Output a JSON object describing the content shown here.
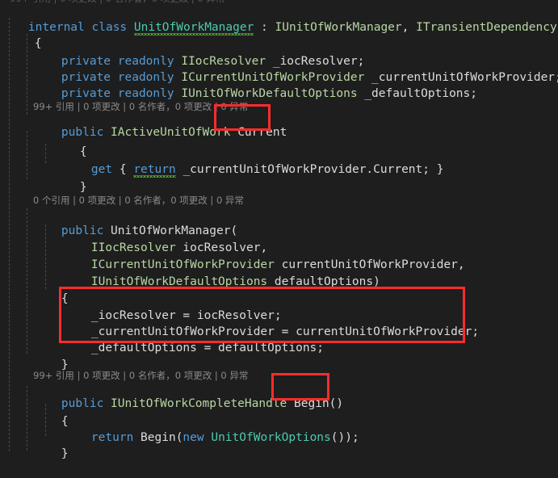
{
  "editor": {
    "theme": "visual-studio-dark",
    "background_color": "#1e1e1e",
    "foreground_color": "#dcdcdc",
    "colors": {
      "keyword": "#569cd6",
      "user_type": "#4ec9b0",
      "interface": "#b8d7a3",
      "identifier": "#dcdcdc",
      "codelens": "#8a8a8a",
      "annotation": "#fb2c2c",
      "squiggle": "#4ea72e",
      "indent_guide": "#4a4a4a"
    },
    "language": "csharp"
  },
  "code": {
    "class_declaration": {
      "modifier": "internal",
      "keyword_class": "class",
      "name": "UnitOfWorkManager",
      "colon": " : ",
      "base_1": "IUnitOfWorkManager",
      "separator": ", ",
      "base_2": "ITransientDependency"
    },
    "brace_open_class": "{",
    "fields": [
      {
        "modifier": "private",
        "readonly": "readonly",
        "type": "IIocResolver",
        "name": " _iocResolver;"
      },
      {
        "modifier": "private",
        "readonly": "readonly",
        "type": "ICurrentUnitOfWorkProvider",
        "name": " _currentUnitOfWorkProvider;"
      },
      {
        "modifier": "private",
        "readonly": "readonly",
        "type": "IUnitOfWorkDefaultOptions",
        "name": " _defaultOptions;"
      }
    ],
    "codelens": [
      "99+ 引用 | 0 项更改 | 0 名作者，0 项更改 | 0 异常",
      "0 个引用 | 0 项更改 | 0 名作者，0 项更改 | 0 异常",
      "99+ 引用 | 0 项更改 | 0 名作者，0 项更改 | 0 异常"
    ],
    "property": {
      "modifier": "public",
      "type": "IActiveUnitOfWork",
      "name": "Current",
      "brace_open": "{",
      "getter": {
        "get_keyword": "get",
        "brace_open": " { ",
        "return_keyword": "return",
        "expression": " _currentUnitOfWorkProvider.Current; ",
        "brace_close": "}"
      },
      "brace_close": "}"
    },
    "constructor": {
      "modifier": "public",
      "name": "UnitOfWorkManager(",
      "parameters": [
        {
          "type": "IIocResolver",
          "name": " iocResolver,"
        },
        {
          "type": "ICurrentUnitOfWorkProvider",
          "name": " currentUnitOfWorkProvider,"
        },
        {
          "type": "IUnitOfWorkDefaultOptions",
          "name": " defaultOptions)"
        }
      ],
      "brace_open": "{",
      "body": [
        "_iocResolver = iocResolver;",
        "_currentUnitOfWorkProvider = currentUnitOfWorkProvider;",
        "_defaultOptions = defaultOptions;"
      ],
      "brace_close": "}"
    },
    "method_begin": {
      "modifier": "public",
      "return_type": "IUnitOfWorkCompleteHandle",
      "name": "Begin()",
      "brace_open": "{",
      "body": {
        "return_keyword": "return",
        "call_prefix": " Begin(",
        "new_keyword": "new",
        "type": " UnitOfWorkOptions",
        "call_suffix": "());"
      },
      "brace_close": "}"
    }
  },
  "annotations": [
    {
      "name": "current-property-highlight",
      "target": "Current"
    },
    {
      "name": "constructor-assignments-highlight",
      "target": "field assignment block"
    },
    {
      "name": "begin-method-highlight",
      "target": "Begin()"
    }
  ]
}
